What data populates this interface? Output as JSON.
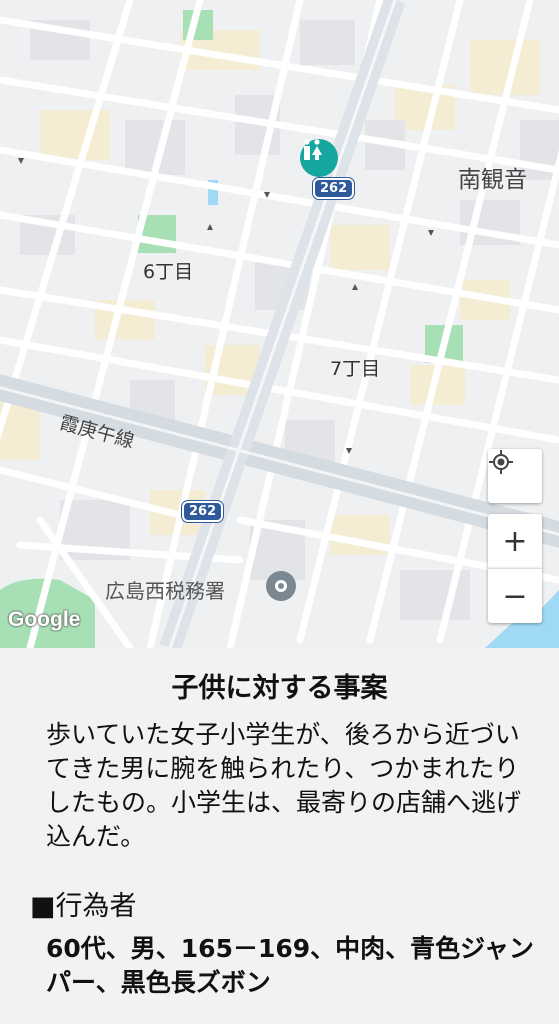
{
  "map": {
    "labels": {
      "minami_kannon": "南観音",
      "chome6": "6丁目",
      "chome7": "7丁目",
      "line": "霞庚午線",
      "tax_office": "広島西税務署"
    },
    "route_shield": "262",
    "google_logo": "Google",
    "controls": {
      "locate_icon": "my-location-icon",
      "zoom_in": "+",
      "zoom_out": "−"
    }
  },
  "panel": {
    "title": "子供に対する事案",
    "description": "歩いていた女子小学生が、後ろから近づいてきた男に腕を触られたり、つかまれたりしたもの。小学生は、最寄りの店舗へ逃げ込んだ。",
    "actor_heading": "■行為者",
    "actor_details": "60代、男、165－169、中肉、青色ジャンパー、黒色長ズボン"
  },
  "colors": {
    "road": "#ffffff",
    "major_road": "#dbe1e6",
    "park": "#a6e0b4",
    "building": "#e2e4e7",
    "yellow_block": "#f4ecd3",
    "water": "#9fd9f3",
    "accent": "#2e5a9c"
  }
}
